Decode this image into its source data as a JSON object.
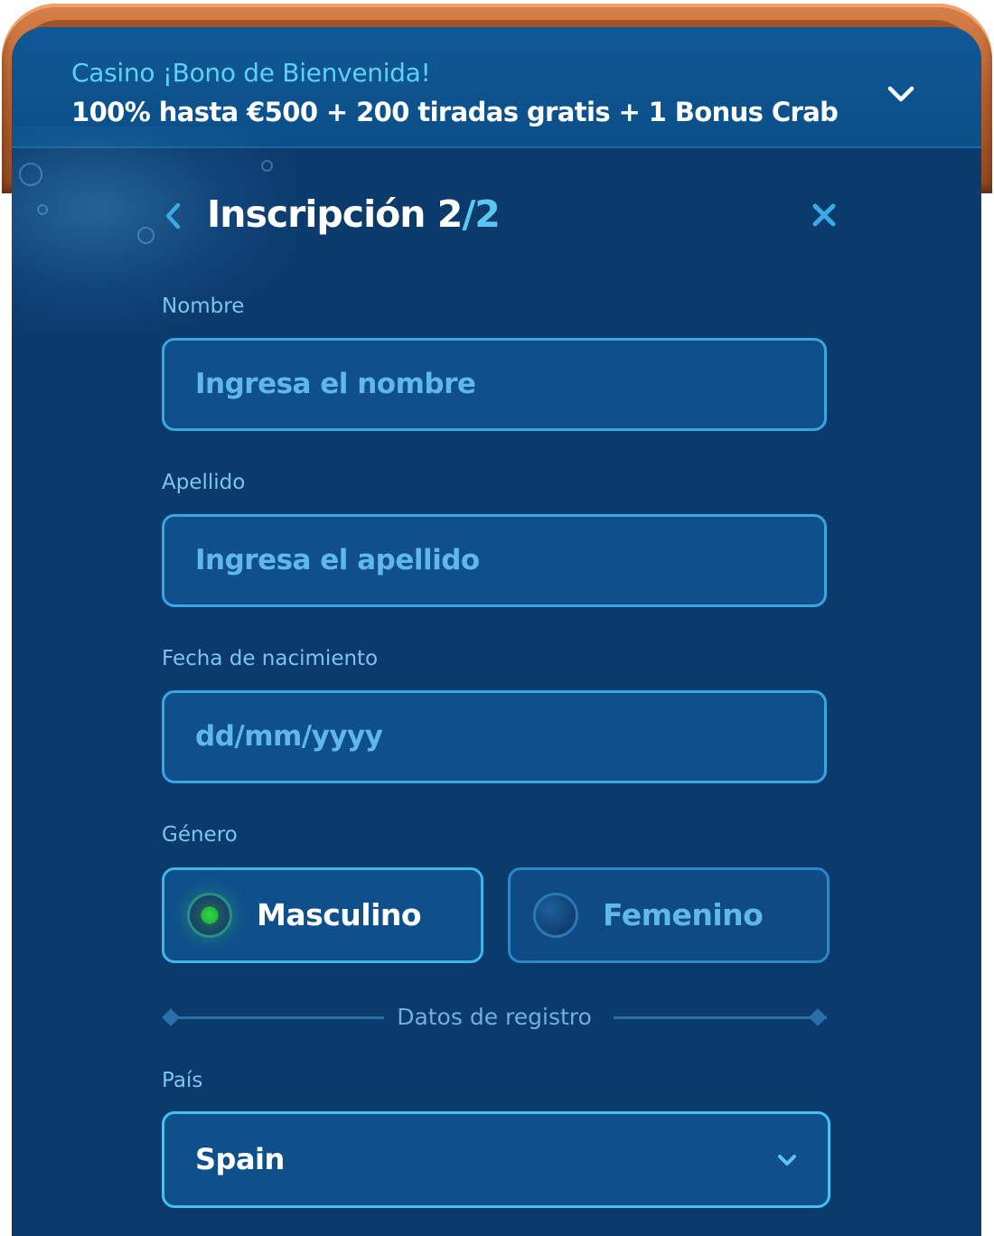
{
  "bonus": {
    "line1": "Casino ¡Bono de Bienvenida!",
    "line2": "100% hasta €500 + 200 tiradas gratis + 1 Bonus Crab",
    "toggle_icon": "chevron-down-icon"
  },
  "header": {
    "title": "Inscripción",
    "step_current": "2",
    "step_total": "/2",
    "back_icon": "chevron-left-icon",
    "close_icon": "close-icon"
  },
  "form": {
    "first_name": {
      "label": "Nombre",
      "placeholder": "Ingresa el nombre"
    },
    "last_name": {
      "label": "Apellido",
      "placeholder": "Ingresa el apellido"
    },
    "birth_date": {
      "label": "Fecha de nacimiento",
      "placeholder": "dd/mm/yyyy"
    },
    "gender": {
      "label": "Género",
      "options": [
        {
          "label": "Masculino",
          "selected": true
        },
        {
          "label": "Femenino",
          "selected": false
        }
      ]
    },
    "section_divider": "Datos de registro",
    "country": {
      "label": "País",
      "value": "Spain"
    }
  },
  "colors": {
    "panel_bg": "#0b3a6c",
    "accent": "#3aa6e0",
    "accent_text": "#5cc6f2",
    "selected_radio": "#2fd84a",
    "frame_wood": "#b9612e"
  }
}
